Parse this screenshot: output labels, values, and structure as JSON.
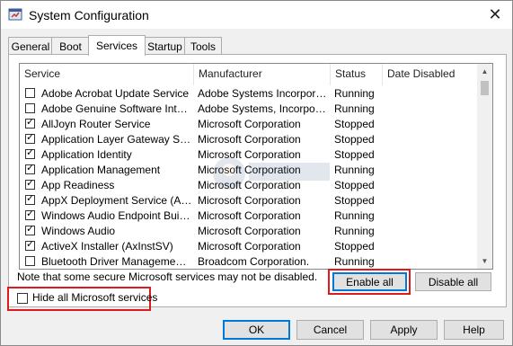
{
  "window": {
    "title": "System Configuration",
    "app_icon": "msconfig-icon",
    "close_icon": "close-icon"
  },
  "tabs": [
    {
      "label": "General"
    },
    {
      "label": "Boot"
    },
    {
      "label": "Services"
    },
    {
      "label": "Startup"
    },
    {
      "label": "Tools"
    }
  ],
  "active_tab": "Services",
  "table": {
    "headers": [
      "Service",
      "Manufacturer",
      "Status",
      "Date Disabled"
    ],
    "rows": [
      {
        "checked": false,
        "service": "Adobe Acrobat Update Service",
        "manufacturer": "Adobe Systems Incorporated",
        "status": "Running"
      },
      {
        "checked": false,
        "service": "Adobe Genuine Software Integri...",
        "manufacturer": "Adobe Systems, Incorpora...",
        "status": "Running"
      },
      {
        "checked": true,
        "service": "AllJoyn Router Service",
        "manufacturer": "Microsoft Corporation",
        "status": "Stopped"
      },
      {
        "checked": true,
        "service": "Application Layer Gateway Service",
        "manufacturer": "Microsoft Corporation",
        "status": "Stopped"
      },
      {
        "checked": true,
        "service": "Application Identity",
        "manufacturer": "Microsoft Corporation",
        "status": "Stopped"
      },
      {
        "checked": true,
        "service": "Application Management",
        "manufacturer": "Microsoft Corporation",
        "status": "Running"
      },
      {
        "checked": true,
        "service": "App Readiness",
        "manufacturer": "Microsoft Corporation",
        "status": "Stopped"
      },
      {
        "checked": true,
        "service": "AppX Deployment Service (AppX...",
        "manufacturer": "Microsoft Corporation",
        "status": "Stopped"
      },
      {
        "checked": true,
        "service": "Windows Audio Endpoint Builder",
        "manufacturer": "Microsoft Corporation",
        "status": "Running"
      },
      {
        "checked": true,
        "service": "Windows Audio",
        "manufacturer": "Microsoft Corporation",
        "status": "Running"
      },
      {
        "checked": true,
        "service": "ActiveX Installer (AxInstSV)",
        "manufacturer": "Microsoft Corporation",
        "status": "Stopped"
      },
      {
        "checked": false,
        "service": "Bluetooth Driver Management S...",
        "manufacturer": "Broadcom Corporation.",
        "status": "Running"
      }
    ]
  },
  "note": "Note that some secure Microsoft services may not be disabled.",
  "buttons": {
    "enable_all": "Enable all",
    "disable_all": "Disable all",
    "ok": "OK",
    "cancel": "Cancel",
    "apply": "Apply",
    "help": "Help"
  },
  "hide_microsoft": {
    "label": "Hide all Microsoft services",
    "checked": false
  },
  "colors": {
    "highlight_box": "#e0191f",
    "default_button_border": "#0078d7"
  }
}
